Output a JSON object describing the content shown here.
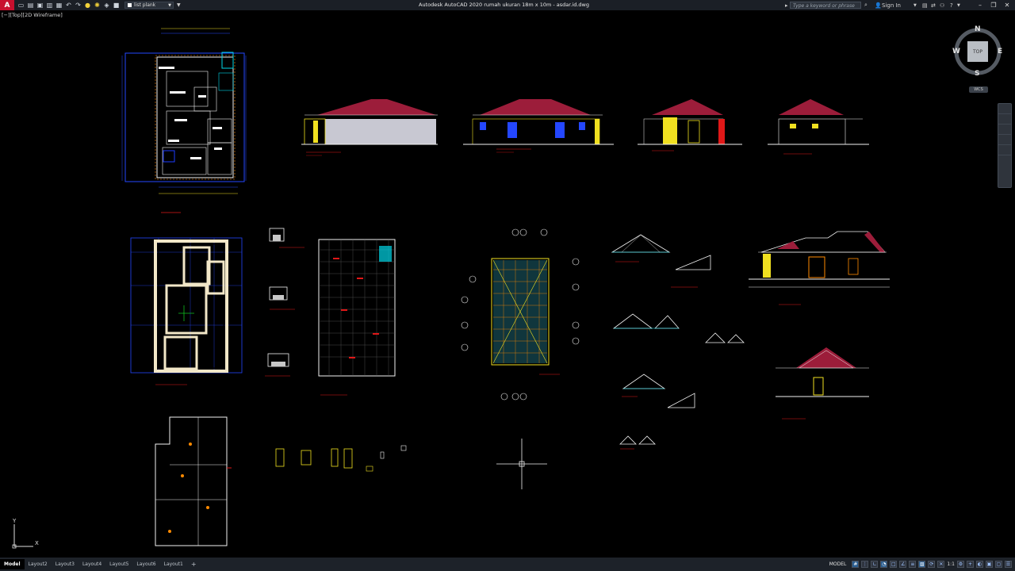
{
  "app": {
    "logo_letter": "A",
    "title": "Autodesk AutoCAD 2020   rumah ukuran 18m x 10m - asdar.id.dwg",
    "layer_name": "list plank"
  },
  "quick_access": {
    "icons": [
      "new-icon",
      "open-icon",
      "save-icon",
      "save-as-icon",
      "plot-icon",
      "undo-icon",
      "redo-icon",
      "lightbulb-icon",
      "sun-icon",
      "layer-icon",
      "square-icon"
    ]
  },
  "search": {
    "placeholder": "Type a keyword or phrase"
  },
  "account": {
    "sign_in": "Sign In"
  },
  "viewport": {
    "label": "[−][Top][2D Wireframe]"
  },
  "viewcube": {
    "north": "N",
    "south": "S",
    "east": "E",
    "west": "W",
    "face": "TOP",
    "wcs": "WCS"
  },
  "ucs": {
    "x_label": "X",
    "y_label": "Y"
  },
  "layout_tabs": [
    "Model",
    "Layout2",
    "Layout3",
    "Layout4",
    "Layout5",
    "Layout6",
    "Layout1"
  ],
  "status": {
    "model_label": "MODEL",
    "scale_label": "1:1",
    "icons": [
      "grid-icon",
      "snap-icon",
      "ortho-icon",
      "polar-icon",
      "osnap-icon",
      "otrack-icon",
      "lineweight-icon",
      "transparency-icon",
      "selection-cycling-icon",
      "annotation-icon",
      "workspace-icon",
      "lock-icon",
      "isolate-icon",
      "hardware-icon",
      "clean-screen-icon",
      "customize-icon"
    ]
  },
  "colors": {
    "background": "#000000",
    "roof": "#9c1d3a",
    "wall_blue": "#1e3cff",
    "dim_blue": "#2447ff",
    "annotation_red": "#e01818",
    "cyan": "#00d7e8",
    "yellow": "#f0e020",
    "white": "#f2f2f2"
  }
}
